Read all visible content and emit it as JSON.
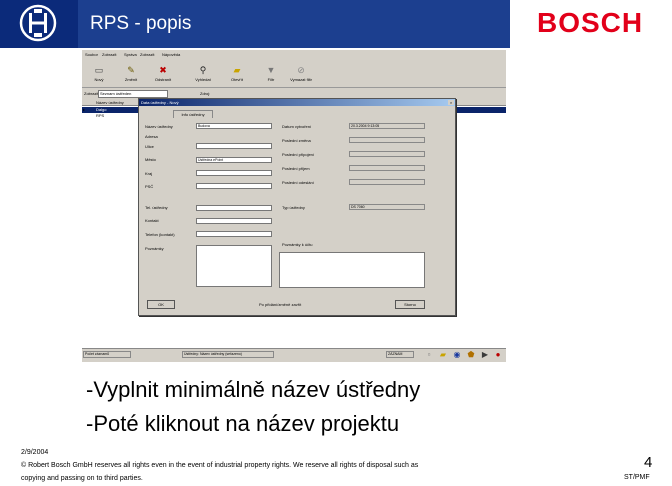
{
  "header": {
    "title": "RPS - popis",
    "brand": "BOSCH",
    "colors": {
      "dark_blue": "#0b2a7a",
      "title_blue": "#1c3f8f",
      "brand_red": "#e2001a"
    }
  },
  "app": {
    "menu": [
      "Soubor",
      "Zobrazit",
      "Správa",
      "Zobrazit",
      "Nápověda"
    ],
    "toolbar": [
      {
        "label": "Nový",
        "icon": "new-document-icon"
      },
      {
        "label": "Změnit",
        "icon": "edit-icon"
      },
      {
        "label": "Odstranit",
        "icon": "delete-icon"
      },
      {
        "label": "Vyhledat",
        "icon": "binoculars-icon"
      },
      {
        "label": "Otevřít",
        "icon": "folder-icon"
      },
      {
        "label": "Filtr",
        "icon": "filter-icon"
      },
      {
        "label": "Vymazat filtr",
        "icon": "clear-filter-icon"
      }
    ],
    "filter": {
      "label": "Zobrazit:",
      "value": "Seznam ústředen",
      "label2": "Zdroj:"
    },
    "grid": {
      "header": "Název ústředny",
      "rows": [
        {
          "marker": "▸",
          "name": "Dalgo",
          "selected": true
        },
        {
          "marker": "",
          "name": "RPS",
          "selected": false
        }
      ]
    },
    "status": {
      "left": "Počet záznamů",
      "middle": "Ústředny: Název ústředny (seřazeno)",
      "right": "ZÁZNAM"
    },
    "dialog": {
      "title": "Data ústředny - Nový",
      "tab": "Info ústředny",
      "left_labels": [
        "Název ústředny",
        "Adresa",
        "Ulice",
        "Město",
        "Kraj",
        "PSČ",
        "Tel. ústředny",
        "Kontakt",
        "Telefon (kontakt)",
        "Poznámky"
      ],
      "left_values": {
        "name": "Budova",
        "city": "Ústředna  ePoint"
      },
      "right_labels": [
        "Datum vytvoření",
        "Poslední změna",
        "Poslední připojení",
        "Poslední přijem",
        "Poslední odeslání",
        "Typ ústředny",
        "Poznámky k účtu"
      ],
      "right_values": {
        "created": "20.3.2004 9:13:05",
        "panel_type": "DS 7060"
      },
      "btn_ok": "OK",
      "check_label": "Po přidání/změně zavřít",
      "btn_cancel": "Storno"
    }
  },
  "bullets": [
    "-Vyplnit minimálně název ústředny",
    "-Poté kliknout na název projektu"
  ],
  "footer": {
    "date": "2/9/2004",
    "copyright_line1": "© Robert Bosch GmbH reserves all rights even in the event of industrial property rights. We reserve all rights of disposal such as",
    "copyright_line2": "copying and passing on to third parties.",
    "page_number": "4",
    "department": "ST/PMF"
  }
}
